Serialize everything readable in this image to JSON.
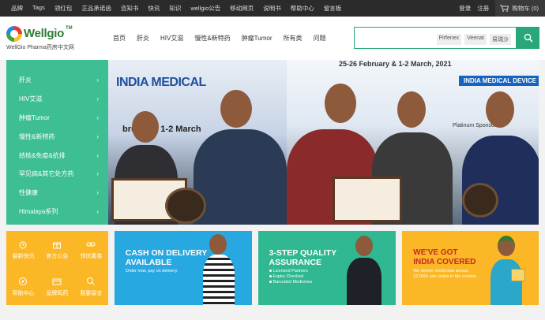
{
  "topbar": {
    "links": [
      "品牌",
      "Tags",
      "领红包",
      "正品承诺函",
      "咨知书",
      "快讯",
      "知识",
      "wellgio公告",
      "移动网页",
      "说明书",
      "帮助中心",
      "留言板"
    ],
    "login": "登录",
    "register": "注册",
    "cart": "购物车 (0)"
  },
  "logo": {
    "name": "Wellgio",
    "tm": "TM",
    "tagline": "WellGio Pharma药房中文网"
  },
  "nav": [
    "首页",
    "肝炎",
    "HIV艾滋",
    "慢性&新特药",
    "肿瘤Tumor",
    "所有类",
    "问题"
  ],
  "search": {
    "tags": [
      "Pirfenex",
      "Veenat",
      "易瑞沙"
    ]
  },
  "sidebar": {
    "items": [
      "肝炎",
      "HIV艾滋",
      "肿瘤Tumor",
      "慢性&新特药",
      "结核&免疫&抗排",
      "罕见病&其它处方药",
      "性健康",
      "Himalaya系列"
    ]
  },
  "hero": {
    "banner_left": "INDIA MEDICAL",
    "banner_left_dates": "bruary & 1-2 March",
    "banner_right_dates": "25-26 February & 1-2 March, 2021",
    "banner_right_title": "INDIA MEDICAL DEVICE",
    "platinum": "Platinum Sponsor"
  },
  "quick": [
    "最新快讯",
    "官方公告",
    "领优惠卷",
    "帮助中心",
    "品牌鸣药",
    "我要留言"
  ],
  "cards": {
    "c1": {
      "title_1": "CASH ON DELIVERY",
      "title_2": "AVAILABLE",
      "sub": "Order now, pay on delivery."
    },
    "c2": {
      "title_1": "3-STEP QUALITY",
      "title_2": "ASSURANCE",
      "b1": "Licensed Partners",
      "b2": "Expiry Checked",
      "b3": "Barcoded Medicines"
    },
    "c3": {
      "title_1": "WE'VE GOT",
      "title_2": "INDIA COVERED",
      "sub1": "We deliver medicines across",
      "sub2": "22,000+ pin codes in the country"
    }
  },
  "colors": {
    "green": "#3dbe93",
    "accent": "#2aa77a",
    "orange": "#fbb726",
    "blue": "#28a8e0",
    "dark": "#2b2b2b"
  }
}
